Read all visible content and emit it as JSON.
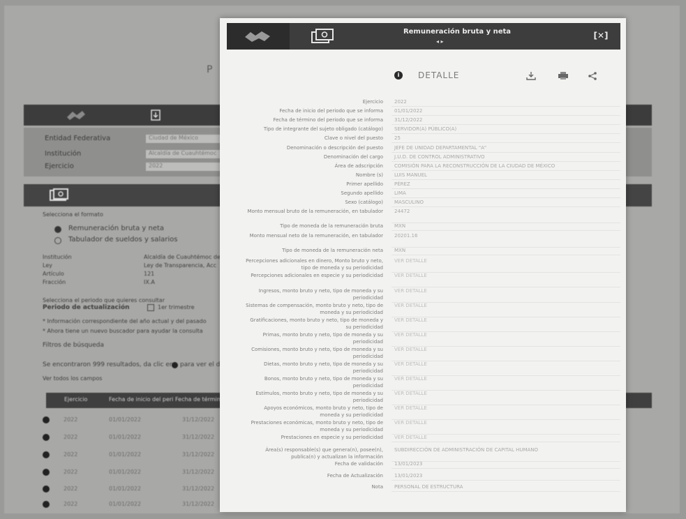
{
  "background": {
    "header_text": "P L",
    "form_rows": [
      {
        "label": "Entidad Federativa",
        "value": "Ciudad de México"
      },
      {
        "label": "Institución",
        "value": "Alcaldía de Cuauhtémoc"
      },
      {
        "label": "Ejercicio",
        "value": "2022"
      }
    ],
    "query_title": "Selecciona el formato",
    "options": [
      {
        "label": "Remuneración bruta y neta",
        "selected": true
      },
      {
        "label": "Tabulador de sueldos y salarios",
        "selected": false
      }
    ],
    "meta": [
      {
        "label": "Institución",
        "value": "Alcaldía de Cuauhtémoc de la"
      },
      {
        "label": "Ley",
        "value": "Ley de Transparencia, Acc"
      },
      {
        "label": "Artículo",
        "value": "121"
      },
      {
        "label": "Fracción",
        "value": "IX.A"
      }
    ],
    "period_hint": "Selecciona el periodo que quieres consultar",
    "period_label": "Periodo de actualización",
    "period_option": "1er trimestre",
    "notes": [
      "* Información correspondiente del año actual y del pasado",
      "* Ahora tiene un nuevo buscador para ayudar la consulta"
    ],
    "filter_link": "Filtros de búsqueda",
    "results_text": "Se encontraron 999 resultados, da clic en",
    "results_suffix": "para ver el detalle",
    "download_link": "Ver todos los campos",
    "table_columns": [
      "Ejercicio",
      "Fecha de inicio del peri",
      "Fecha de término"
    ],
    "table_rows": [
      {
        "c1": "2022",
        "c2": "01/01/2022",
        "c3": "31/12/2022"
      },
      {
        "c1": "2022",
        "c2": "01/01/2022",
        "c3": "31/12/2022"
      },
      {
        "c1": "2022",
        "c2": "01/01/2022",
        "c3": "31/12/2022"
      },
      {
        "c1": "2022",
        "c2": "01/01/2022",
        "c3": "31/12/2022"
      },
      {
        "c1": "2022",
        "c2": "01/01/2022",
        "c3": "31/12/2022"
      },
      {
        "c1": "2022",
        "c2": "01/01/2022",
        "c3": "31/12/2022"
      }
    ]
  },
  "modal": {
    "title": "Remuneración bruta y neta",
    "subtitle_arrows": "◂ ▸",
    "close_label": "[✕]",
    "detail_label": "DETALLE",
    "icons": {
      "info": "info-icon",
      "download": "download-icon",
      "print": "print-icon",
      "share": "share-icon",
      "close": "close-icon",
      "logo": "logo-icon",
      "money": "money-icon"
    },
    "rows": [
      {
        "label": "Ejercicio",
        "value": "2022"
      },
      {
        "label": "Fecha de inicio del periodo que se informa",
        "value": "01/01/2022"
      },
      {
        "label": "Fecha de término del periodo que se informa",
        "value": "31/12/2022"
      },
      {
        "label": "Tipo de integrante del sujeto obligado (catálogo)",
        "value": "Servidor(a) público(a)"
      },
      {
        "label": "Clave o nivel del puesto",
        "value": "25"
      },
      {
        "label": "Denominación o descripción del puesto",
        "value": "JEFE DE UNIDAD DEPARTAMENTAL \"A\""
      },
      {
        "label": "Denominación del cargo",
        "value": "J.U.D. DE CONTROL ADMINISTRATIVO"
      },
      {
        "label": "Área de adscripción",
        "value": "COMISIÓN PARA LA RECONSTRUCCIÓN DE LA CIUDAD DE MÉXICO"
      },
      {
        "label": "Nombre (s)",
        "value": "LUIS MANUEL"
      },
      {
        "label": "Primer apellido",
        "value": "PÉREZ"
      },
      {
        "label": "Segundo apellido",
        "value": "LIMA"
      },
      {
        "label": "Sexo (catálogo)",
        "value": "Masculino"
      },
      {
        "label": "Monto mensual bruto de la remuneración, en tabulador",
        "value": "24472"
      },
      {
        "label": "Tipo de moneda de la remuneración bruta",
        "value": "MXN"
      },
      {
        "label": "Monto mensual neto de la remuneración, en tabulador",
        "value": "20201.16"
      },
      {
        "label": "Tipo de moneda de la remuneración neta",
        "value": "MXN"
      },
      {
        "label": "Percepciones adicionales en dinero, Monto bruto y neto, tipo de moneda y su periodicidad",
        "value": "Ver detalle"
      },
      {
        "label": "Percepciones adicionales en especie y su periodicidad",
        "value": "Ver detalle"
      },
      {
        "label": "Ingresos, monto bruto y neto, tipo de moneda y su periodicidad",
        "value": "Ver detalle"
      },
      {
        "label": "Sistemas de compensación, monto bruto y neto, tipo de moneda y su periodicidad",
        "value": "Ver detalle"
      },
      {
        "label": "Gratificaciones, monto bruto y neto, tipo de moneda y su periodicidad",
        "value": "Ver detalle"
      },
      {
        "label": "Primas, monto bruto y neto, tipo de moneda y su periodicidad",
        "value": "Ver detalle"
      },
      {
        "label": "Comisiones, monto bruto y neto, tipo de moneda y su periodicidad",
        "value": "Ver detalle"
      },
      {
        "label": "Dietas, monto bruto y neto, tipo de moneda y su periodicidad",
        "value": "Ver detalle"
      },
      {
        "label": "Bonos, monto bruto y neto, tipo de moneda y su periodicidad",
        "value": "Ver detalle"
      },
      {
        "label": "Estímulos, monto bruto y neto, tipo de moneda y su periodicidad",
        "value": "Ver detalle"
      },
      {
        "label": "Apoyos económicos, monto bruto y neto, tipo de moneda y su periodicidad",
        "value": "Ver detalle"
      },
      {
        "label": "Prestaciones económicas, monto bruto y neto, tipo de moneda y su periodicidad",
        "value": "Ver detalle"
      },
      {
        "label": "Prestaciones en especie y su periodicidad",
        "value": "Ver detalle"
      },
      {
        "label": "Área(s) responsable(s) que genera(n), posee(n), publica(n) y actualizan la información",
        "value": "SUBDIRECCIÓN DE ADMINISTRACIÓN DE CAPITAL HUMANO"
      },
      {
        "label": "Fecha de validación",
        "value": "13/01/2023"
      },
      {
        "label": "Fecha de Actualización",
        "value": "13/01/2023"
      },
      {
        "label": "Nota",
        "value": "PERSONAL DE ESTRUCTURA"
      }
    ]
  },
  "colors": {
    "header_dark": "#3d3d3d",
    "modal_bg": "#f2f2f0",
    "label_text": "#7d7d7d",
    "value_text": "#a9a9a9"
  }
}
